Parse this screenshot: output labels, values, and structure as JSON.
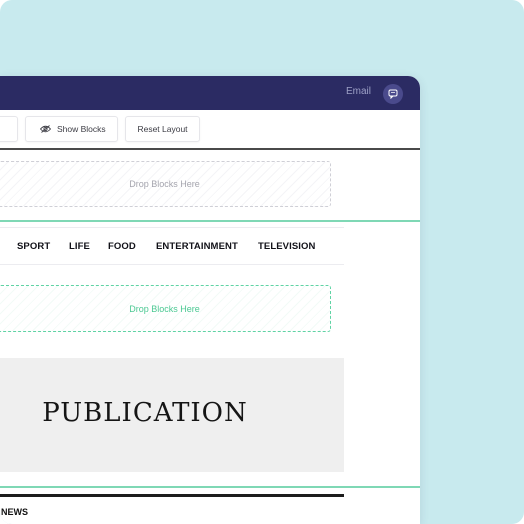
{
  "colors": {
    "background": "#c8eaee",
    "topbar": "#2b2b63",
    "accent_green": "#5fd3a4"
  },
  "topbar": {
    "email_label": "Email",
    "chat_icon": "chat-bubble-icon"
  },
  "toolbar": {
    "show_blocks_label": "Show Blocks",
    "show_blocks_icon": "eye-icon",
    "reset_layout_label": "Reset Layout"
  },
  "canvas": {
    "drop_zone_top_label": "Drop Blocks Here",
    "nav_items": [
      "SPORT",
      "LIFE",
      "FOOD",
      "ENTERTAINMENT",
      "TELEVISION"
    ],
    "drop_zone_active_label": "Drop Blocks Here",
    "publication_title": "PUBLICATION",
    "section_label": "NEWS"
  }
}
